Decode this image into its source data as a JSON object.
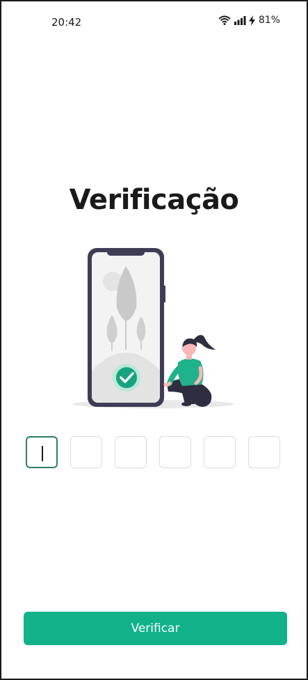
{
  "status_bar": {
    "time": "20:42",
    "battery": "81%",
    "icons": [
      "wifi-icon",
      "signal-icon",
      "charging-icon"
    ]
  },
  "page": {
    "title": "Verificação"
  },
  "code_input": {
    "length": 6,
    "values": [
      "",
      "",
      "",
      "",
      "",
      ""
    ],
    "active_index": 0
  },
  "actions": {
    "verify_label": "Verificar"
  },
  "colors": {
    "accent": "#11b28a",
    "active_border": "#2e7d64",
    "phone_frame": "#3f3d56",
    "figure_shirt": "#20b28a"
  }
}
